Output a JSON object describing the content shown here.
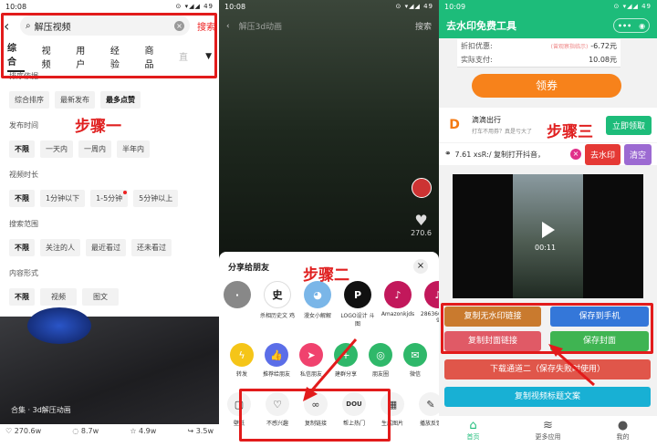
{
  "panel1": {
    "status_time": "10:08",
    "status_icons": "⊙ ▾◢◢ 49",
    "search_query": "解压视频",
    "search_button": "搜索",
    "tabs": [
      "综合",
      "视频",
      "用户",
      "经验",
      "商品",
      "直"
    ],
    "sections": [
      {
        "title": "排序依据",
        "options": [
          "综合排序",
          "最新发布",
          "最多点赞"
        ],
        "selected": 2
      },
      {
        "title": "发布时间",
        "options": [
          "不限",
          "一天内",
          "一周内",
          "半年内"
        ],
        "selected": 0
      },
      {
        "title": "视频时长",
        "options": [
          "不限",
          "1分钟以下",
          "1-5分钟",
          "5分钟以上"
        ],
        "selected": 0
      },
      {
        "title": "搜索范围",
        "options": [
          "不限",
          "关注的人",
          "最近看过",
          "还未看过"
        ],
        "selected": 0
      },
      {
        "title": "内容形式",
        "options": [
          "不限",
          "视频",
          "图文"
        ],
        "selected": 0
      }
    ],
    "step_label": "步骤一",
    "video_title": "合集 · 3d解压动画",
    "actions": [
      "270.6w",
      "8.7w",
      "4.9w",
      "3.5w"
    ]
  },
  "panel2": {
    "status_time": "10:08",
    "status_icons": "⊙ ▾◢◢ 49",
    "top_title": "解压3d动画",
    "top_search": "搜索",
    "like_count": "270.6",
    "step_label": "步骤二",
    "sheet_title": "分享给朋友",
    "friends": [
      {
        "name": "",
        "color": "#888888",
        "glyph": "·"
      },
      {
        "name": "杀相历史文 鸡",
        "color": "#ffffff",
        "glyph": "史"
      },
      {
        "name": "漫女小解解",
        "color": "#7ab6e8",
        "glyph": "◕"
      },
      {
        "name": "LOGO设计 斗图",
        "color": "#111111",
        "glyph": "P"
      },
      {
        "name": "Amazonkjds",
        "color": "#c2185b",
        "glyph": "♪"
      },
      {
        "name": "2863666926 9",
        "color": "#c2185b",
        "glyph": "♪"
      },
      {
        "name": "dy3i",
        "color": "#c2185b",
        "glyph": "♪"
      }
    ],
    "apps": [
      {
        "name": "转发",
        "color": "#f5c518",
        "glyph": "ϟ"
      },
      {
        "name": "推荐给朋友",
        "color": "#5b6ee8",
        "glyph": "👍"
      },
      {
        "name": "私信朋友",
        "color": "#f0426e",
        "glyph": "➤"
      },
      {
        "name": "建群分享",
        "color": "#2fb86a",
        "glyph": "+"
      },
      {
        "name": "朋友圈",
        "color": "#2fb86a",
        "glyph": "◎"
      },
      {
        "name": "微信",
        "color": "#2fb86a",
        "glyph": "✉"
      }
    ],
    "ops": [
      {
        "name": "壁纸",
        "glyph": "▢"
      },
      {
        "name": "不感兴趣",
        "glyph": "♡"
      },
      {
        "name": "复制链接",
        "glyph": "∞"
      },
      {
        "name": "帮上热门",
        "glyph": "DOU"
      },
      {
        "name": "生成图片",
        "glyph": "▦"
      },
      {
        "name": "播放反馈",
        "glyph": "✎"
      }
    ]
  },
  "panel3": {
    "status_time": "10:09",
    "status_icons": "⊙ ▾◢◢ 49",
    "app_title": "去水印免费工具",
    "discount_label": "折扣优惠:",
    "discount_note": "(曾观察指临示)",
    "discount_value": "-6.72元",
    "pay_label": "实际支付:",
    "pay_value": "10.08元",
    "coupon_button": "领券",
    "didi_name": "滴滴出行",
    "didi_sub": "打车不用券？真是亏大了",
    "didi_button": "立即领取",
    "link_text": "7.61 xsR:/ 复制打开抖音，",
    "remove_button": "去水印",
    "clear_button": "清空",
    "video_time": "00:11",
    "step_label": "步骤三",
    "buttons": {
      "copy_nowm": "复制无水印链接",
      "save_phone": "保存到手机",
      "copy_cover": "复制封面链接",
      "save_cover": "保存封面",
      "download2": "下载通道二（保存失败时使用）",
      "copy_desc": "复制视频标题文案"
    },
    "nav": [
      "首页",
      "更多应用",
      "我的"
    ]
  }
}
